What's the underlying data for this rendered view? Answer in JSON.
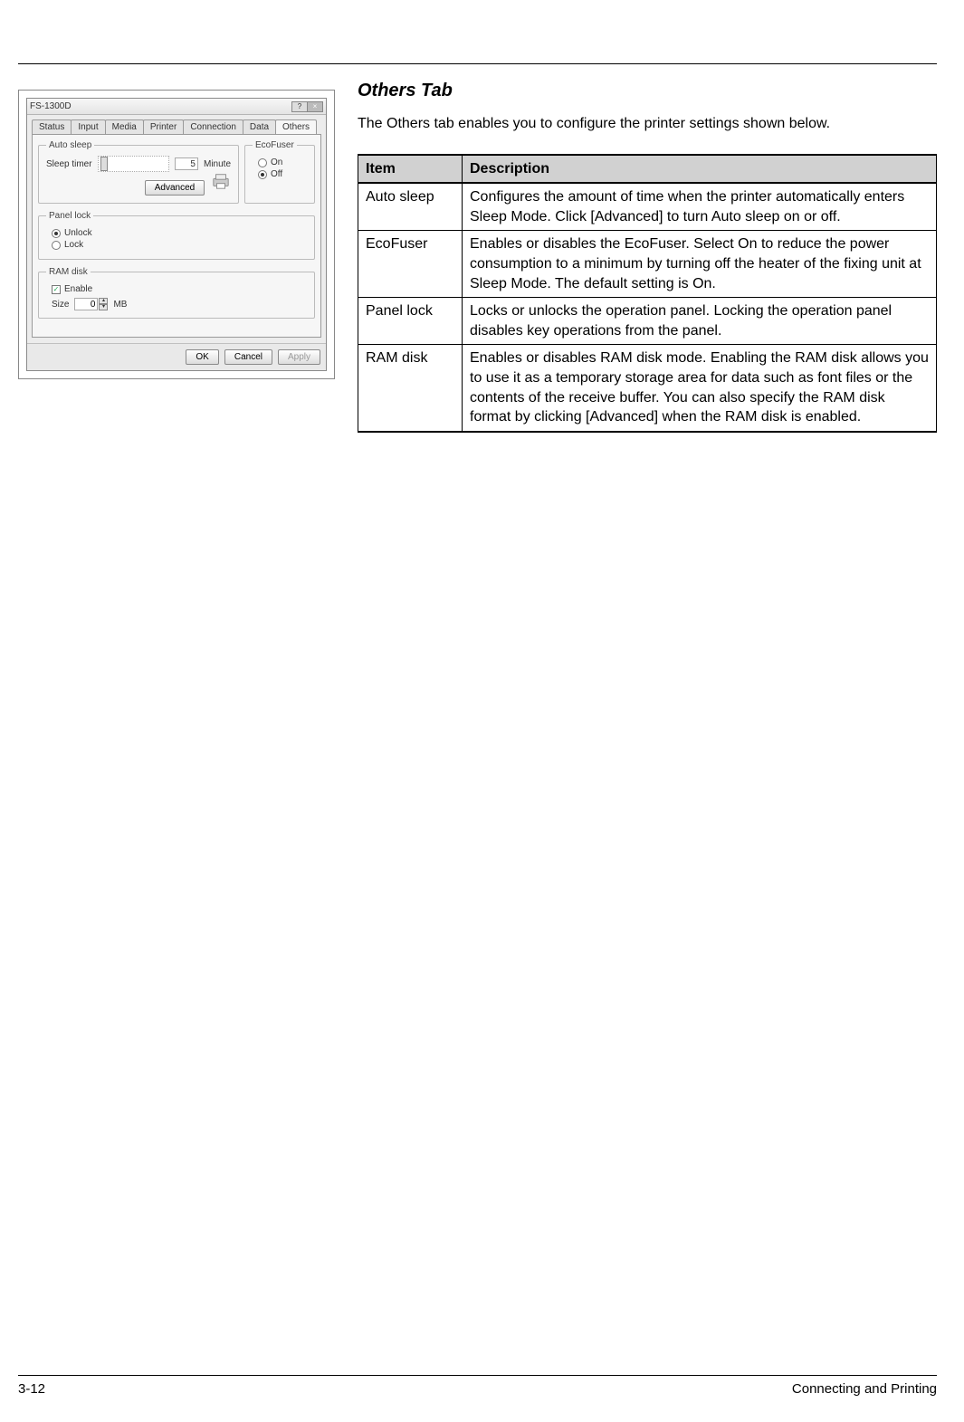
{
  "page": {
    "section_title": "Others Tab",
    "intro": "The Others tab enables you to configure the printer settings  shown below.",
    "footer_left": "3-12",
    "footer_right": "Connecting and Printing"
  },
  "table": {
    "head_item": "Item",
    "head_desc": "Description",
    "rows": [
      {
        "item": "Auto sleep",
        "desc": "Configures the amount of time when the printer automatically enters Sleep Mode. Click [Advanced] to turn Auto sleep on or off."
      },
      {
        "item": "EcoFuser",
        "desc": "Enables or disables the EcoFuser. Select On to reduce the power consumption to a minimum by turning off the heater of the fixing unit at Sleep Mode. The default setting is On."
      },
      {
        "item": "Panel lock",
        "desc": "Locks or unlocks the operation panel. Locking the operation panel disables key operations from the panel."
      },
      {
        "item": "RAM disk",
        "desc": "Enables or disables RAM disk mode. Enabling the RAM disk allows you to use it as a temporary storage area for data such as font files or the contents of the receive buffer. You can also specify the RAM disk format by clicking [Advanced] when the RAM disk is enabled."
      }
    ]
  },
  "dialog": {
    "title": "FS-1300D",
    "win_help": "?",
    "win_close": "×",
    "tabs": [
      "Status",
      "Input",
      "Media",
      "Printer",
      "Connection",
      "Data",
      "Others"
    ],
    "active_tab_index": 6,
    "groups": {
      "auto_sleep": {
        "legend": "Auto sleep",
        "label_sleep_timer": "Sleep timer",
        "value": "5",
        "unit": "Minute",
        "advanced": "Advanced"
      },
      "ecofuser": {
        "legend": "EcoFuser",
        "on": "On",
        "off": "Off",
        "selected": "off"
      },
      "panel_lock": {
        "legend": "Panel lock",
        "unlock": "Unlock",
        "lock": "Lock",
        "selected": "unlock"
      },
      "ram_disk": {
        "legend": "RAM disk",
        "enable": "Enable",
        "size_label": "Size",
        "size_value": "0",
        "size_unit": "MB",
        "enabled": true
      }
    },
    "buttons": {
      "ok": "OK",
      "cancel": "Cancel",
      "apply": "Apply"
    }
  }
}
